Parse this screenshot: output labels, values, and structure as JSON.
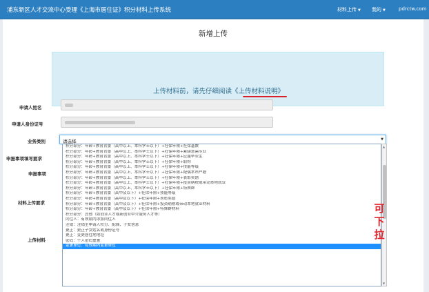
{
  "navbar": {
    "title": "浦东新区人才交流中心受理《上海市居住证》积分材料上传系统",
    "menu": [
      {
        "label": "材料上传"
      },
      {
        "label": "我的"
      }
    ],
    "site": "pdrctw.com"
  },
  "page": {
    "title": "新增上传"
  },
  "notice": {
    "prefix": "上传材料前，请先仔细阅读",
    "link": "《上传材料说明》",
    "underline_color": "#d9202a"
  },
  "form": {
    "name_label": "申请人姓名",
    "id_label": "申请人身份证号",
    "business_label": "业务类别",
    "items_fill_label": "申报事项填写要求",
    "items_label": "申报事项",
    "upload_req_label": "材料上传要求",
    "upload_label": "上传材料",
    "select_value": "请选择"
  },
  "options": [
    "积分部分：年龄+教育背景（高中以上、本科学士以下）+社保年限+社保基数",
    "积分部分：年龄+教育背景（高中以上、本科学士以下）+社保年限+紧缺急需专业",
    "积分部分：年龄+教育背景（高中以上、本科学士以下）+社保年限+应届毕业生",
    "积分部分：年龄+教育背景（高中以上、本科学士以下）+社保年限+职称",
    "积分部分：年龄+教育背景（高中以上、本科学士以下）+社保年限+技能等级",
    "积分部分：年龄+教育背景（高中以上、本科学士以下）+社保年限+配偶本市户籍",
    "积分部分：年龄+教育背景（高中以上、本科学士以下）+社保年限+表彰奖励",
    "积分部分：年龄+教育背景（高中以上、本科学士以下）+社保年限+投资纳税或带动本地就业",
    "积分部分：年龄+教育背景（高中以上、本科学士以下）+社保年限+特殊群",
    "积分部分：年龄+教育背景（高中及以下）+社保年限+技能等级",
    "积分部分：年龄+教育背景（高中及以下）+社保年限+表彰奖励",
    "积分部分：年龄+教育背景（高中及以下）+社保年限+投资纳税或带动本地就业材料",
    "积分部分：年龄+教育背景（高中及以下）+社保年限+特殊群材料",
    "积分部分：其他（如创业人才或新创业中介服务人才等）",
    "同住人：有效期内添加同住人",
    "注销：注销主申请人积分、配偶、子女信息",
    "更正：更正子女姓名或身份证号",
    "更正：变更居住地地址",
    "密码：个人密码重置",
    "变更单位：有效期内变更单位"
  ],
  "selected_option_index": 19,
  "annotation": [
    "可",
    "下",
    "拉"
  ],
  "colors": {
    "navbar": "#2c7fc0",
    "notice_bg": "#d9edf7",
    "selected": "#1e90ff",
    "annotation": "#e3262d"
  }
}
